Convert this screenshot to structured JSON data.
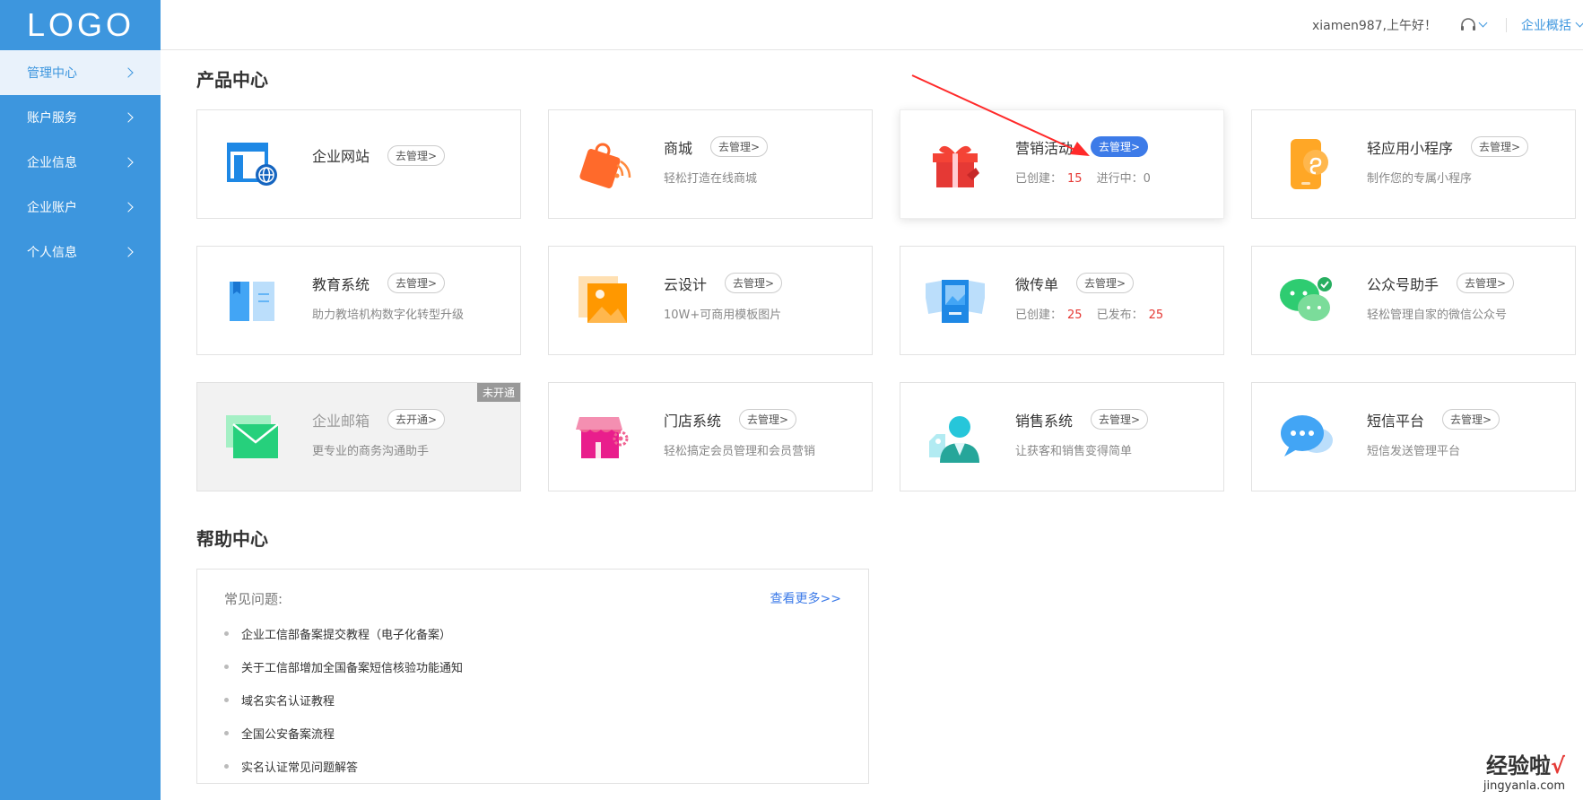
{
  "sidebar": {
    "logo": "LOGO",
    "items": [
      {
        "label": "管理中心",
        "active": true
      },
      {
        "label": "账户服务"
      },
      {
        "label": "企业信息"
      },
      {
        "label": "企业账户"
      },
      {
        "label": "个人信息"
      }
    ]
  },
  "topbar": {
    "greeting": "xiamen987,上午好！",
    "overview": "企业概括"
  },
  "product_center": {
    "title": "产品中心",
    "cards": [
      {
        "name": "企业网站",
        "button": "去管理>",
        "desc": "",
        "icon": "website-icon"
      },
      {
        "name": "商城",
        "button": "去管理>",
        "desc": "轻松打造在线商城",
        "icon": "shopping-bag-icon"
      },
      {
        "name": "营销活动",
        "button": "去管理>",
        "created_label": "已创建：",
        "created": "15",
        "ongoing_label": "进行中：",
        "ongoing": "0",
        "icon": "gift-icon"
      },
      {
        "name": "轻应用小程序",
        "button": "去管理>",
        "desc": "制作您的专属小程序",
        "icon": "mini-program-icon"
      },
      {
        "name": "教育系统",
        "button": "去管理>",
        "desc": "助力教培机构数字化转型升级",
        "icon": "book-icon"
      },
      {
        "name": "云设计",
        "button": "去管理>",
        "desc": "10W+可商用模板图片",
        "icon": "image-icon"
      },
      {
        "name": "微传单",
        "button": "去管理>",
        "created_label": "已创建：",
        "created": "25",
        "published_label": "已发布：",
        "published": "25",
        "icon": "flyer-icon"
      },
      {
        "name": "公众号助手",
        "button": "去管理>",
        "desc": "轻松管理自家的微信公众号",
        "icon": "wechat-icon"
      },
      {
        "name": "企业邮箱",
        "button": "去开通>",
        "desc": "更专业的商务沟通助手",
        "badge": "未开通",
        "icon": "mail-icon"
      },
      {
        "name": "门店系统",
        "button": "去管理>",
        "desc": "轻松搞定会员管理和会员营销",
        "icon": "store-icon"
      },
      {
        "name": "销售系统",
        "button": "去管理>",
        "desc": "让获客和销售变得简单",
        "icon": "sales-person-icon"
      },
      {
        "name": "短信平台",
        "button": "去管理>",
        "desc": "短信发送管理平台",
        "icon": "sms-icon"
      }
    ]
  },
  "help_center": {
    "title": "帮助中心",
    "faq_label": "常见问题:",
    "more": "查看更多>>",
    "items": [
      "企业工信部备案提交教程（电子化备案）",
      "关于工信部增加全国备案短信核验功能通知",
      "域名实名认证教程",
      "全国公安备案流程",
      "实名认证常见问题解答"
    ]
  },
  "watermark": {
    "line1": "经验啦",
    "check": "√",
    "line2": "jingyanla.com"
  },
  "colors": {
    "sidebar": "#3d96de",
    "primary": "#3d7be8",
    "red": "#e53935"
  }
}
